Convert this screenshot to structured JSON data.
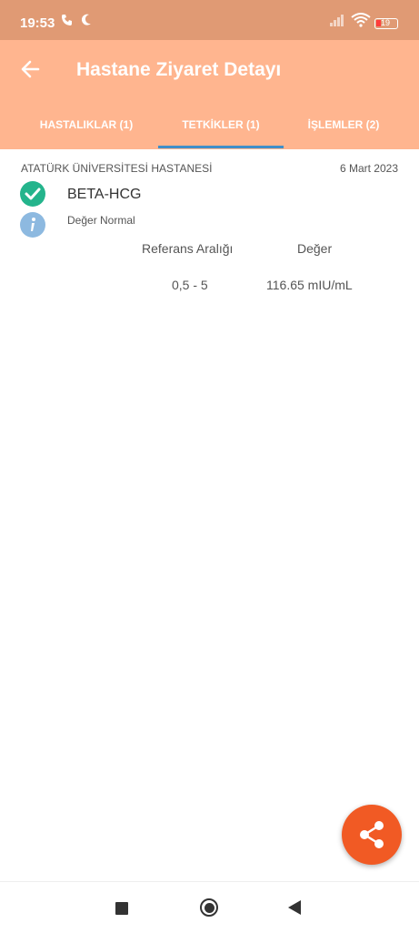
{
  "status_bar": {
    "time": "19:53",
    "battery": "19"
  },
  "header": {
    "title": "Hastane Ziyaret Detayı"
  },
  "tabs": [
    {
      "label": "HASTALIKLAR (1)"
    },
    {
      "label": "TETKİKLER (1)"
    },
    {
      "label": "İŞLEMLER (2)"
    }
  ],
  "record": {
    "hospital": "ATATÜRK ÜNİVERSİTESİ HASTANESİ",
    "date": "6 Mart 2023",
    "test_name": "BETA-HCG",
    "status": "Değer Normal",
    "ref_header": "Referans Aralığı",
    "value_header": "Değer",
    "ref_range": "0,5 - 5",
    "value": "116.65 mIU/mL"
  },
  "colors": {
    "appbar": "#ffb58f",
    "statusbar": "#e09a74",
    "accent": "#3f8fc9",
    "fab": "#f15a24",
    "check": "#24b48c",
    "info": "#8db9e0"
  }
}
